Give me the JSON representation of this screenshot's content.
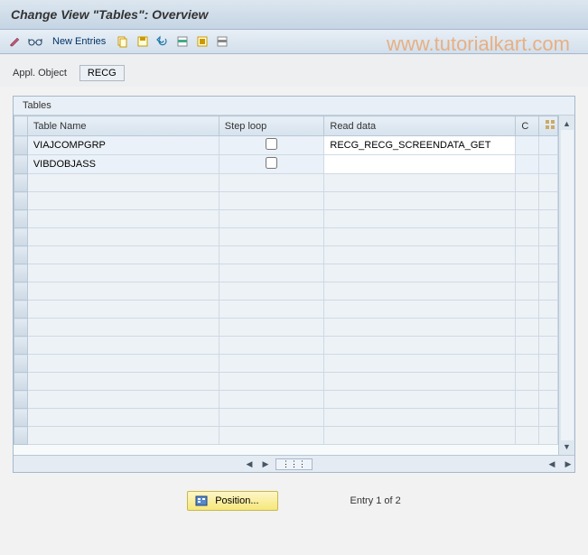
{
  "header": {
    "title": "Change View \"Tables\": Overview"
  },
  "toolbar": {
    "new_entries": "New Entries",
    "icons": {
      "change": "change-icon",
      "glasses": "glasses-icon",
      "copy": "copy-icon",
      "save": "save-icon",
      "undo": "undo-icon",
      "select": "select-icon",
      "selectall": "select-all-icon",
      "deselect": "deselect-icon"
    }
  },
  "appl_object": {
    "label": "Appl. Object",
    "value": "RECG"
  },
  "table": {
    "title": "Tables",
    "columns": {
      "name": "Table Name",
      "steploop": "Step loop",
      "readdata": "Read data",
      "c": "C"
    },
    "rows": [
      {
        "name": "VIAJCOMPGRP",
        "steploop": false,
        "readdata": "RECG_RECG_SCREENDATA_GET"
      },
      {
        "name": "VIBDOBJASS",
        "steploop": false,
        "readdata": ""
      }
    ],
    "empty_row_count": 15
  },
  "footer": {
    "position_label": "Position...",
    "status": "Entry 1 of 2"
  },
  "watermark": "www.tutorialkart.com"
}
